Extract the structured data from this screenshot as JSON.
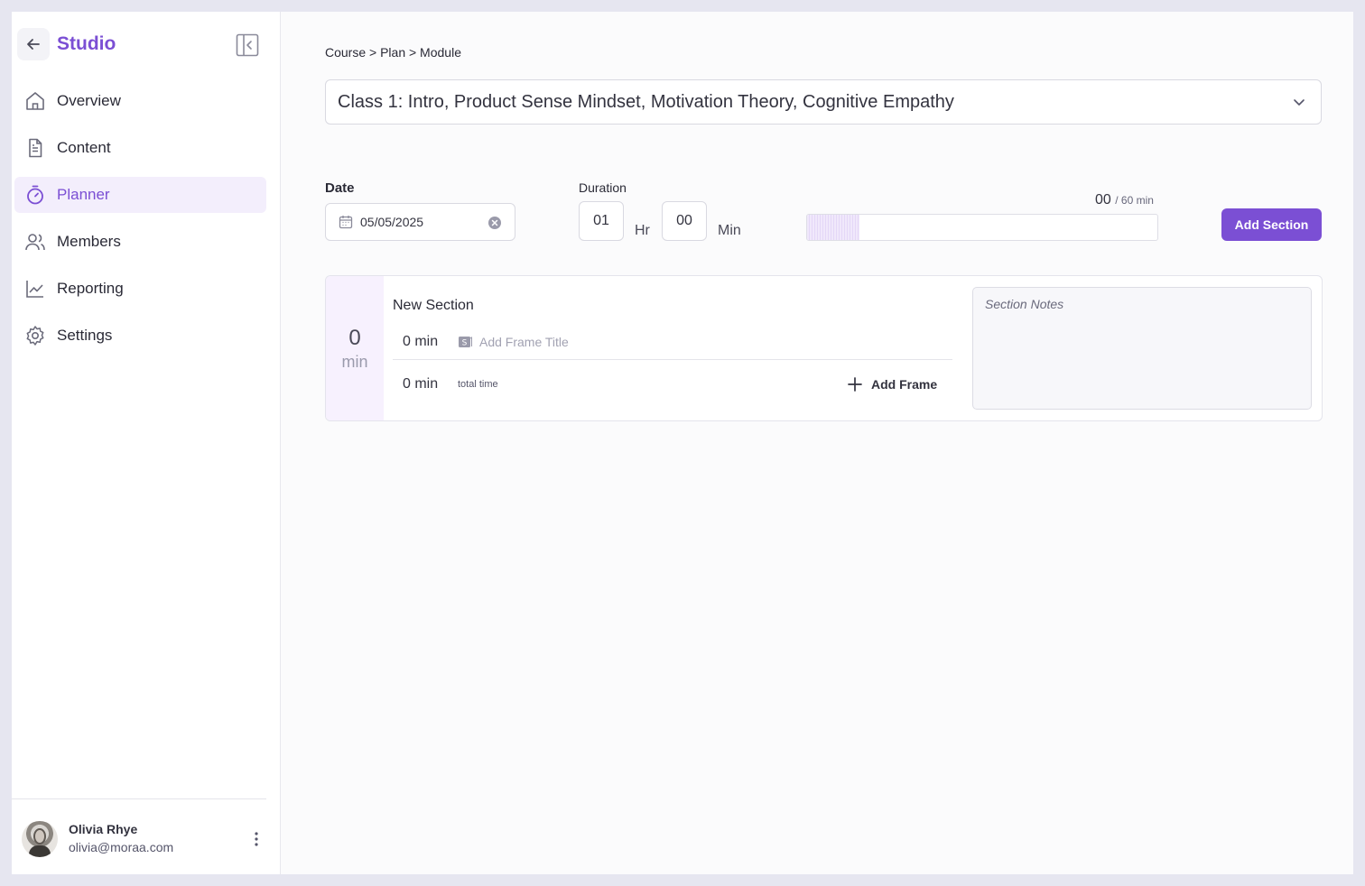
{
  "sidebar": {
    "brand": "Studio",
    "items": [
      {
        "label": "Overview",
        "icon": "home-icon",
        "active": false
      },
      {
        "label": "Content",
        "icon": "document-icon",
        "active": false
      },
      {
        "label": "Planner",
        "icon": "timer-icon",
        "active": true
      },
      {
        "label": "Members",
        "icon": "users-icon",
        "active": false
      },
      {
        "label": "Reporting",
        "icon": "chart-icon",
        "active": false
      },
      {
        "label": "Settings",
        "icon": "gear-icon",
        "active": false
      }
    ],
    "profile": {
      "name": "Olivia Rhye",
      "email": "olivia@moraa.com"
    }
  },
  "main": {
    "breadcrumb": "Course > Plan > Module",
    "module_select": {
      "value": "Class 1: Intro, Product Sense Mindset, Motivation Theory, Cognitive Empathy"
    },
    "date": {
      "label": "Date",
      "value": "05/05/2025"
    },
    "duration": {
      "label": "Duration",
      "hours": "01",
      "hours_unit": "Hr",
      "minutes": "00",
      "minutes_unit": "Min"
    },
    "progress": {
      "used": "00",
      "total": "/ 60 min",
      "fill_fraction": 0.15
    },
    "add_section_label": "Add Section",
    "section": {
      "time_value": "0",
      "time_unit": "min",
      "title": "New Section",
      "frame_minutes": "0 min",
      "frame_title_placeholder": "Add Frame Title",
      "total_minutes": "0 min",
      "total_label": "total time",
      "add_frame_label": "Add Frame",
      "notes_placeholder": "Section Notes"
    }
  },
  "colors": {
    "accent": "#7b4fd4",
    "active_bg": "#f3eefc",
    "section_time_bg": "#f7f1fe"
  }
}
